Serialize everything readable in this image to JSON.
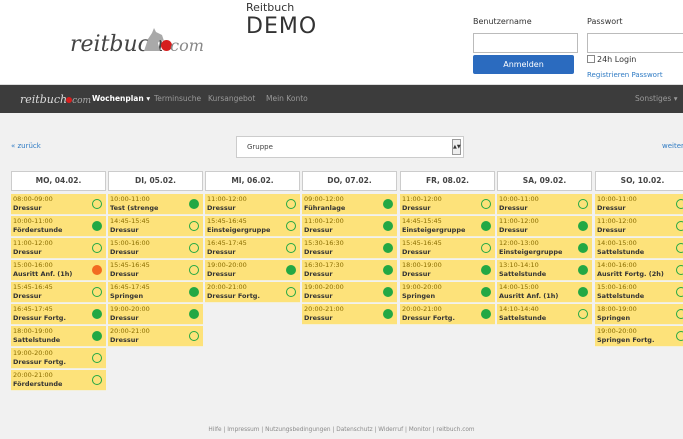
{
  "header": {
    "app_title": "Reitbuch",
    "demo_label": "DEMO",
    "logo_text": "reitbuch",
    "logo_com": "com"
  },
  "login": {
    "username_label": "Benutzername",
    "password_label": "Passwort",
    "username_value": "",
    "password_value": "",
    "login_button": "Anmelden",
    "remember_label": "24h Login",
    "register_link": "Registrieren Passwort"
  },
  "nav": {
    "logo_text": "reitbuch",
    "logo_com": "com",
    "items": [
      {
        "label": "Wochenplan ▾",
        "active": true
      },
      {
        "label": "Terminsuche"
      },
      {
        "label": "Kursangebot"
      },
      {
        "label": "Mein Konto"
      }
    ],
    "right_item": "Sonstiges ▾"
  },
  "controls": {
    "back": "« zurück",
    "forward": "weiter",
    "group_select": "Gruppe"
  },
  "days": [
    {
      "header": "MO, 04.02.",
      "slots": [
        {
          "time": "08:00-09:00",
          "name": "Dressur",
          "status": "open"
        },
        {
          "time": "10:00-11:00",
          "name": "Förderstunde",
          "status": "full"
        },
        {
          "time": "11:00-12:00",
          "name": "Dressur",
          "status": "open"
        },
        {
          "time": "15:00-16:00",
          "name": "Ausritt Anf. (1h)",
          "status": "wait"
        },
        {
          "time": "15:45-16:45",
          "name": "Dressur",
          "status": "open"
        },
        {
          "time": "16:45-17:45",
          "name": "Dressur Fortg.",
          "status": "full"
        },
        {
          "time": "18:00-19:00",
          "name": "Sattelstunde",
          "status": "full"
        },
        {
          "time": "19:00-20:00",
          "name": "Dressur Fortg.",
          "status": "open"
        },
        {
          "time": "20:00-21:00",
          "name": "Förderstunde",
          "status": "open"
        }
      ]
    },
    {
      "header": "DI, 05.02.",
      "slots": [
        {
          "time": "10:00-11:00",
          "name": "Test (strenge",
          "status": "full"
        },
        {
          "time": "14:45-15:45",
          "name": "Dressur",
          "status": "open"
        },
        {
          "time": "15:00-16:00",
          "name": "Dressur",
          "status": "open"
        },
        {
          "time": "15:45-16:45",
          "name": "Dressur",
          "status": "open"
        },
        {
          "time": "16:45-17:45",
          "name": "Springen",
          "status": "full"
        },
        {
          "time": "19:00-20:00",
          "name": "Dressur",
          "status": "full"
        },
        {
          "time": "20:00-21:00",
          "name": "Dressur",
          "status": "open"
        }
      ]
    },
    {
      "header": "MI, 06.02.",
      "slots": [
        {
          "time": "11:00-12:00",
          "name": "Dressur",
          "status": "open"
        },
        {
          "time": "15:45-16:45",
          "name": "Einsteigergruppe",
          "status": "open"
        },
        {
          "time": "16:45-17:45",
          "name": "Dressur",
          "status": "open"
        },
        {
          "time": "19:00-20:00",
          "name": "Dressur",
          "status": "full"
        },
        {
          "time": "20:00-21:00",
          "name": "Dressur Fortg.",
          "status": "open"
        }
      ]
    },
    {
      "header": "DO, 07.02.",
      "slots": [
        {
          "time": "09:00-12:00",
          "name": "Führanlage",
          "status": "full"
        },
        {
          "time": "11:00-12:00",
          "name": "Dressur",
          "status": "full"
        },
        {
          "time": "15:30-16:30",
          "name": "Dressur",
          "status": "full"
        },
        {
          "time": "16:30-17:30",
          "name": "Dressur",
          "status": "full"
        },
        {
          "time": "19:00-20:00",
          "name": "Dressur",
          "status": "full"
        },
        {
          "time": "20:00-21:00",
          "name": "Dressur",
          "status": "full"
        }
      ]
    },
    {
      "header": "FR, 08.02.",
      "slots": [
        {
          "time": "11:00-12:00",
          "name": "Dressur",
          "status": "open"
        },
        {
          "time": "14:45-15:45",
          "name": "Einsteigergruppe",
          "status": "full"
        },
        {
          "time": "15:45-16:45",
          "name": "Dressur",
          "status": "open"
        },
        {
          "time": "18:00-19:00",
          "name": "Dressur",
          "status": "full"
        },
        {
          "time": "19:00-20:00",
          "name": "Springen",
          "status": "full"
        },
        {
          "time": "20:00-21:00",
          "name": "Dressur Fortg.",
          "status": "full"
        }
      ]
    },
    {
      "header": "SA, 09.02.",
      "slots": [
        {
          "time": "10:00-11:00",
          "name": "Dressur",
          "status": "open"
        },
        {
          "time": "11:00-12:00",
          "name": "Dressur",
          "status": "full"
        },
        {
          "time": "12:00-13:00",
          "name": "Einsteigergruppe",
          "status": "full"
        },
        {
          "time": "13:10-14:10",
          "name": "Sattelstunde",
          "status": "full"
        },
        {
          "time": "14:00-15:00",
          "name": "Ausritt Anf. (1h)",
          "status": "full"
        },
        {
          "time": "14:10-14:40",
          "name": "Sattelstunde",
          "status": "open"
        }
      ]
    },
    {
      "header": "SO, 10.02.",
      "slots": [
        {
          "time": "10:00-11:00",
          "name": "Dressur",
          "status": "open"
        },
        {
          "time": "11:00-12:00",
          "name": "Dressur",
          "status": "open"
        },
        {
          "time": "14:00-15:00",
          "name": "Sattelstunde",
          "status": "open"
        },
        {
          "time": "14:00-16:00",
          "name": "Ausritt Fortg. (2h)",
          "status": "open"
        },
        {
          "time": "15:00-16:00",
          "name": "Sattelstunde",
          "status": "open"
        },
        {
          "time": "18:00-19:00",
          "name": "Springen",
          "status": "open"
        },
        {
          "time": "19:00-20:00",
          "name": "Springen Fortg.",
          "status": "open"
        }
      ]
    }
  ],
  "footer": "Hilfe | Impressum | Nutzungsbedingungen | Datenschutz | Widerruf | Monitor | reitbuch.com",
  "colors": {
    "slot_bg": "#fde27a",
    "status_green": "#23a844",
    "status_orange": "#f26b21",
    "nav_bg": "#3c3c3c",
    "button_blue": "#2b6bbf",
    "link_blue": "#2f7bc4"
  }
}
